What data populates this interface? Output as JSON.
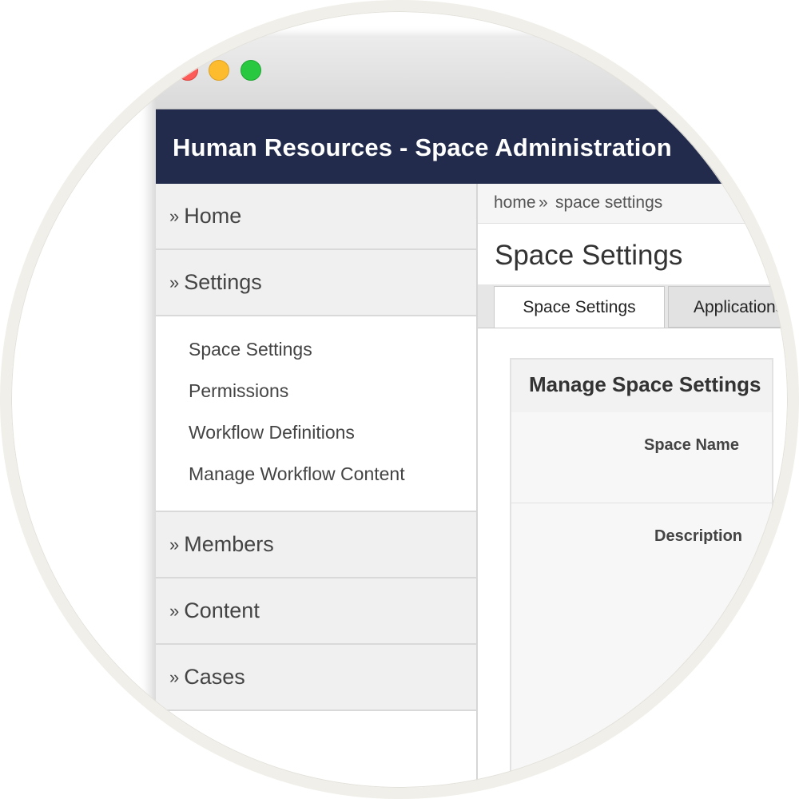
{
  "app": {
    "title": "Human Resources - Space Administration"
  },
  "sidebar": {
    "sections": [
      {
        "label": "Home"
      },
      {
        "label": "Settings"
      }
    ],
    "settings_items": [
      {
        "label": "Space Settings"
      },
      {
        "label": "Permissions"
      },
      {
        "label": "Workflow Definitions"
      },
      {
        "label": "Manage Workflow Content"
      }
    ],
    "more_sections": [
      {
        "label": "Members"
      },
      {
        "label": "Content"
      },
      {
        "label": "Cases"
      }
    ],
    "bullet": "»"
  },
  "breadcrumb": {
    "home": "home",
    "separator": "»",
    "current": "space settings"
  },
  "main": {
    "page_title": "Space Settings",
    "tabs": [
      {
        "label": "Space Settings",
        "active": true
      },
      {
        "label": "Applications",
        "active": false
      }
    ],
    "panel": {
      "title": "Manage Space Settings",
      "fields": [
        {
          "label": "Space Name"
        },
        {
          "label": "Description"
        }
      ]
    }
  },
  "colors": {
    "app_bar": "#222b4c",
    "close": "#fc5b57",
    "minimize": "#fdbc2e",
    "zoom": "#28c840"
  }
}
